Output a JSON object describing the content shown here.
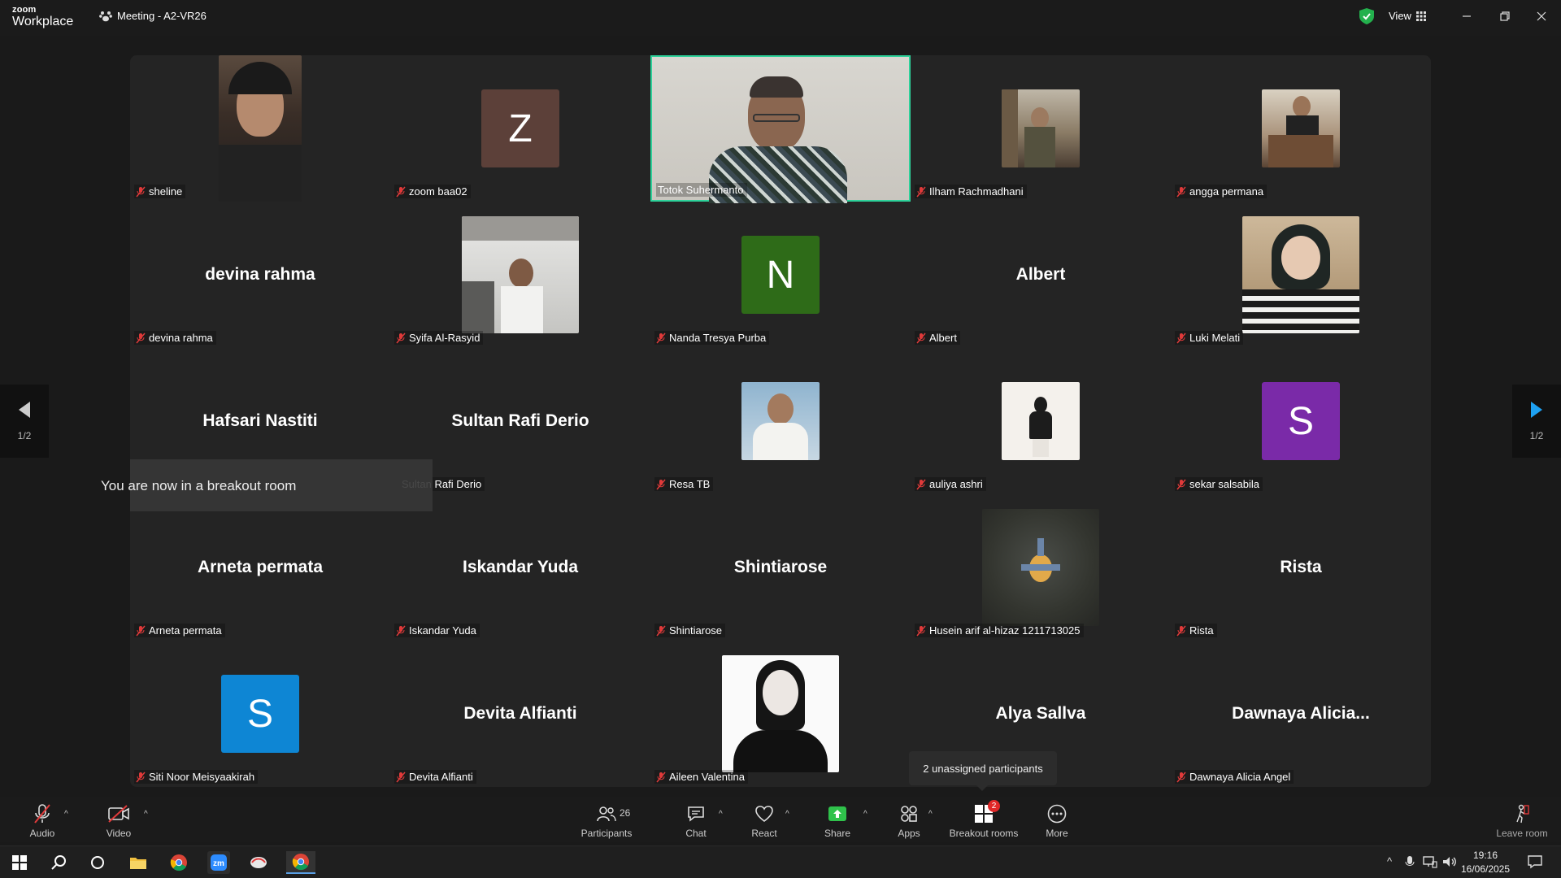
{
  "app": {
    "logo_top": "zoom",
    "logo_bottom": "Workplace",
    "meeting_title": "Meeting - A2-VR26",
    "view_label": "View"
  },
  "colors": {
    "active_border": "#2ed19a",
    "avatar_z": "#5c4039",
    "avatar_n": "#2e6b18",
    "avatar_s_purple": "#7a2aa8",
    "avatar_s_blue": "#0e86d4",
    "muted_red": "#e03a3a",
    "share_green": "#2fc24b"
  },
  "tiles": [
    {
      "name": "sheline",
      "kind": "photo"
    },
    {
      "name": "zoom baa02",
      "kind": "avatar",
      "letter": "Z"
    },
    {
      "name": "Totok Suhermanto",
      "kind": "video"
    },
    {
      "name": "Ilham Rachmadhani",
      "kind": "photo"
    },
    {
      "name": "angga permana",
      "kind": "photo"
    },
    {
      "name": "devina rahma",
      "kind": "text",
      "display": "devina rahma"
    },
    {
      "name": "Syifa Al-Rasyid",
      "kind": "photo"
    },
    {
      "name": "Nanda Tresya Purba",
      "kind": "avatar",
      "letter": "N"
    },
    {
      "name": "Albert",
      "kind": "text",
      "display": "Albert"
    },
    {
      "name": "Luki Melati",
      "kind": "photo"
    },
    {
      "name": "Hafsari Nastiti",
      "kind": "text",
      "display": "Hafsari Nastiti"
    },
    {
      "name": "Sultan Rafi Derio",
      "kind": "text",
      "display": "Sultan Rafi Derio"
    },
    {
      "name": "Resa TB",
      "kind": "photo"
    },
    {
      "name": "auliya ashri",
      "kind": "photo"
    },
    {
      "name": "sekar salsabila",
      "kind": "avatar",
      "letter": "S"
    },
    {
      "name": "Arneta permata",
      "kind": "text",
      "display": "Arneta permata"
    },
    {
      "name": "Iskandar Yuda",
      "kind": "text",
      "display": "Iskandar Yuda"
    },
    {
      "name": "Shintiarose",
      "kind": "text",
      "display": "Shintiarose"
    },
    {
      "name": "Husein arif al-hizaz 1211713025",
      "kind": "photo"
    },
    {
      "name": "Rista",
      "kind": "text",
      "display": "Rista"
    },
    {
      "name": "Siti Noor Meisyaakirah",
      "kind": "avatar",
      "letter": "S"
    },
    {
      "name": "Devita Alfianti",
      "kind": "text",
      "display": "Devita Alfianti"
    },
    {
      "name": "Aileen Valentina",
      "kind": "photo"
    },
    {
      "name": "Alya Sallva",
      "kind": "text",
      "display": "Alya Sallva"
    },
    {
      "name": "Dawnaya Alicia Angel",
      "kind": "text",
      "display": "Dawnaya  Alicia..."
    }
  ],
  "toast": "You are now in a breakout room",
  "pager": {
    "prev": "1/2",
    "next": "1/2"
  },
  "tooltip": "2 unassigned participants",
  "toolbar": {
    "audio": "Audio",
    "video": "Video",
    "participants": "Participants",
    "participants_count": "26",
    "chat": "Chat",
    "react": "React",
    "share": "Share",
    "apps": "Apps",
    "breakout": "Breakout rooms",
    "breakout_badge": "2",
    "more": "More",
    "leave": "Leave room"
  },
  "taskbar": {
    "time": "19:16",
    "date": "16/06/2025"
  }
}
